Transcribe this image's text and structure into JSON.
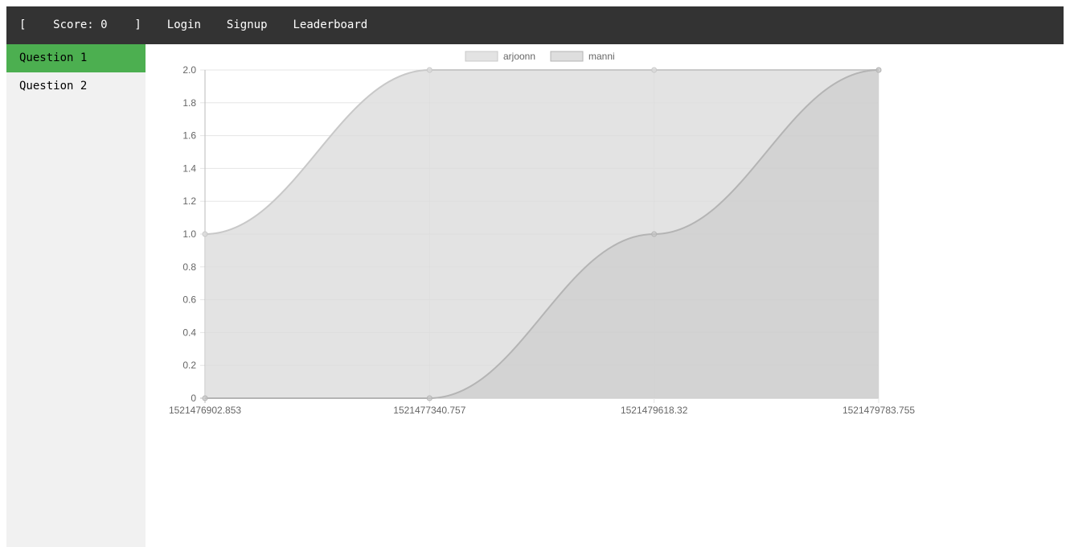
{
  "topbar": {
    "score_bracket_open": "[",
    "score_label": "Score:",
    "score_value": "0",
    "score_bracket_close": "]",
    "links": [
      {
        "label": "Login"
      },
      {
        "label": "Signup"
      },
      {
        "label": "Leaderboard"
      }
    ],
    "background": "#333333"
  },
  "sidebar": {
    "items": [
      {
        "label": "Question 1",
        "active": true
      },
      {
        "label": "Question 2",
        "active": false
      }
    ],
    "active_color": "#4caf50"
  },
  "chart_data": {
    "type": "area",
    "x": [
      "1521476902.853",
      "1521477340.757",
      "1521479618.32",
      "1521479783.755"
    ],
    "series": [
      {
        "name": "arjoonn",
        "values": [
          1,
          2,
          2,
          2
        ],
        "fill": "rgba(220,220,220,0.8)",
        "stroke": "rgba(200,200,200,1)"
      },
      {
        "name": "manni",
        "values": [
          0,
          0,
          1,
          2
        ],
        "fill": "rgba(200,200,200,0.6)",
        "stroke": "rgba(180,180,180,1)"
      }
    ],
    "ylim": [
      0,
      2.0
    ],
    "yticks": [
      "0",
      "0.2",
      "0.4",
      "0.6",
      "0.8",
      "1.0",
      "1.2",
      "1.4",
      "1.6",
      "1.8",
      "2.0"
    ],
    "grid": true,
    "legend": "top"
  }
}
